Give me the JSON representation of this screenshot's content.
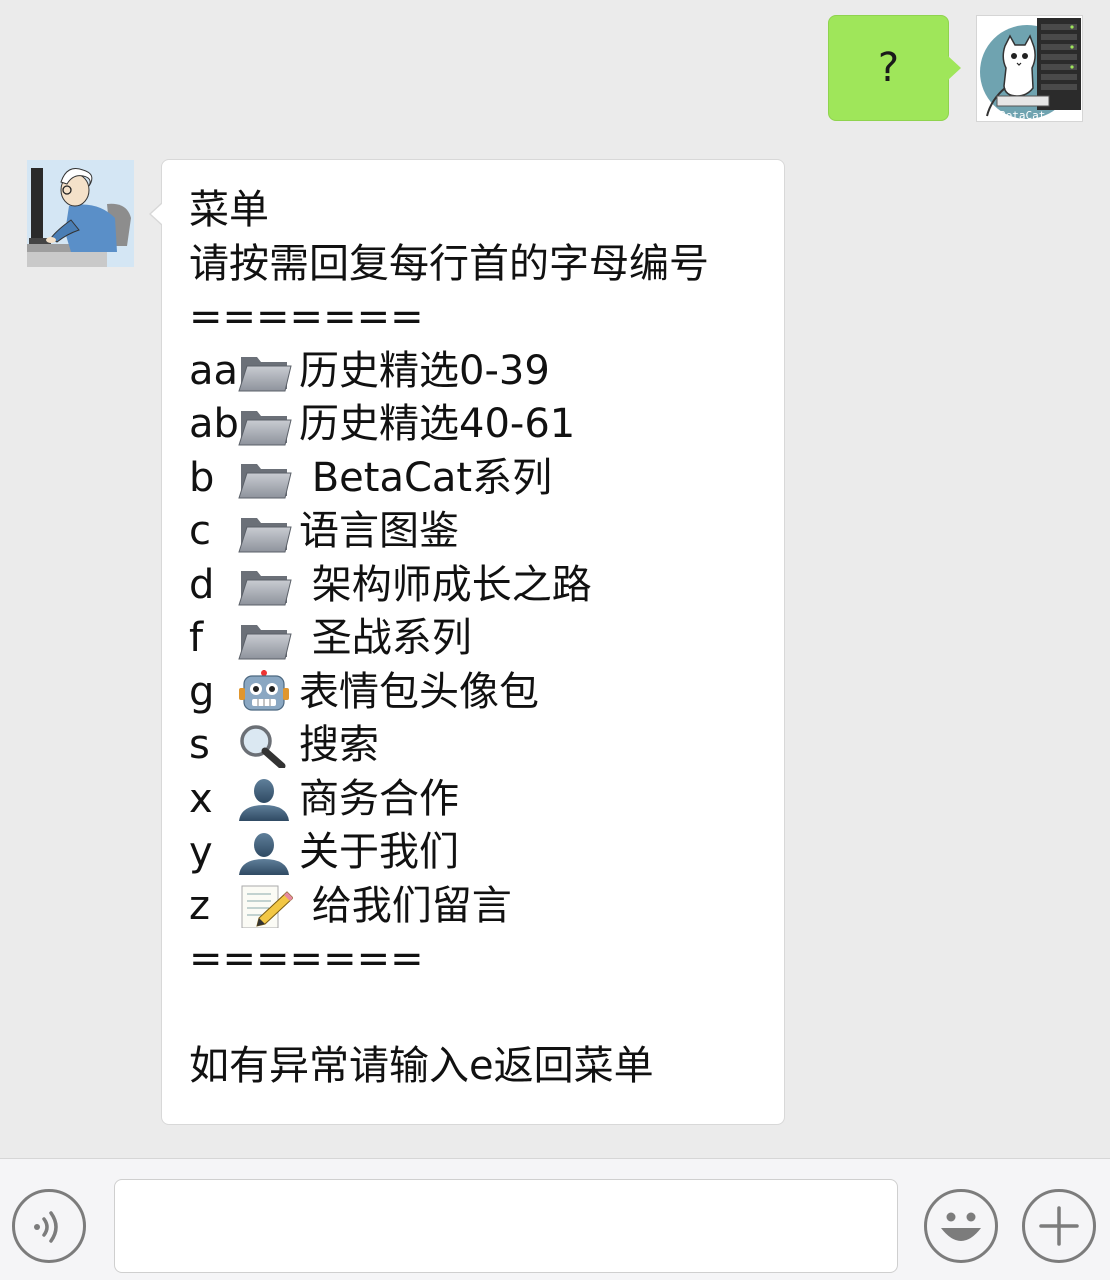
{
  "conversation": {
    "outgoing_message": "?",
    "me_avatar_label": "BetaCat",
    "incoming_lines": [
      {
        "text": "菜单"
      },
      {
        "text": "请按需回复每行首的字母编号"
      },
      {
        "text": "======="
      }
    ],
    "menu_items": [
      {
        "key": "aa",
        "icon": "folder-icon",
        "label": "历史精选0-39"
      },
      {
        "key": "ab",
        "icon": "folder-icon",
        "label": "历史精选40-61"
      },
      {
        "key": "b",
        "icon": "folder-icon",
        "label": " BetaCat系列"
      },
      {
        "key": "c",
        "icon": "folder-icon",
        "label": "语言图鉴"
      },
      {
        "key": "d",
        "icon": "folder-icon",
        "label": " 架构师成长之路"
      },
      {
        "key": "f",
        "icon": "folder-icon",
        "label": " 圣战系列"
      },
      {
        "key": "g",
        "icon": "robot-icon",
        "label": "表情包头像包"
      },
      {
        "key": "s",
        "icon": "magnifier-icon",
        "label": "搜索"
      },
      {
        "key": "x",
        "icon": "person-icon",
        "label": "商务合作"
      },
      {
        "key": "y",
        "icon": "person-icon",
        "label": "关于我们"
      },
      {
        "key": "z",
        "icon": "memo-icon",
        "label": " 给我们留言"
      }
    ],
    "footer_lines": [
      {
        "text": "======="
      },
      {
        "text": ""
      },
      {
        "text": "如有异常请输入e返回菜单"
      }
    ]
  },
  "input_bar": {
    "voice_icon": "voice-icon",
    "text_value": "",
    "emoji_icon": "smiley-icon",
    "more_icon": "plus-icon"
  },
  "colors": {
    "background": "#ebebeb",
    "outgoing_bubble": "#9fe65a",
    "incoming_bubble": "#ffffff",
    "input_bar": "#f5f5f7"
  }
}
